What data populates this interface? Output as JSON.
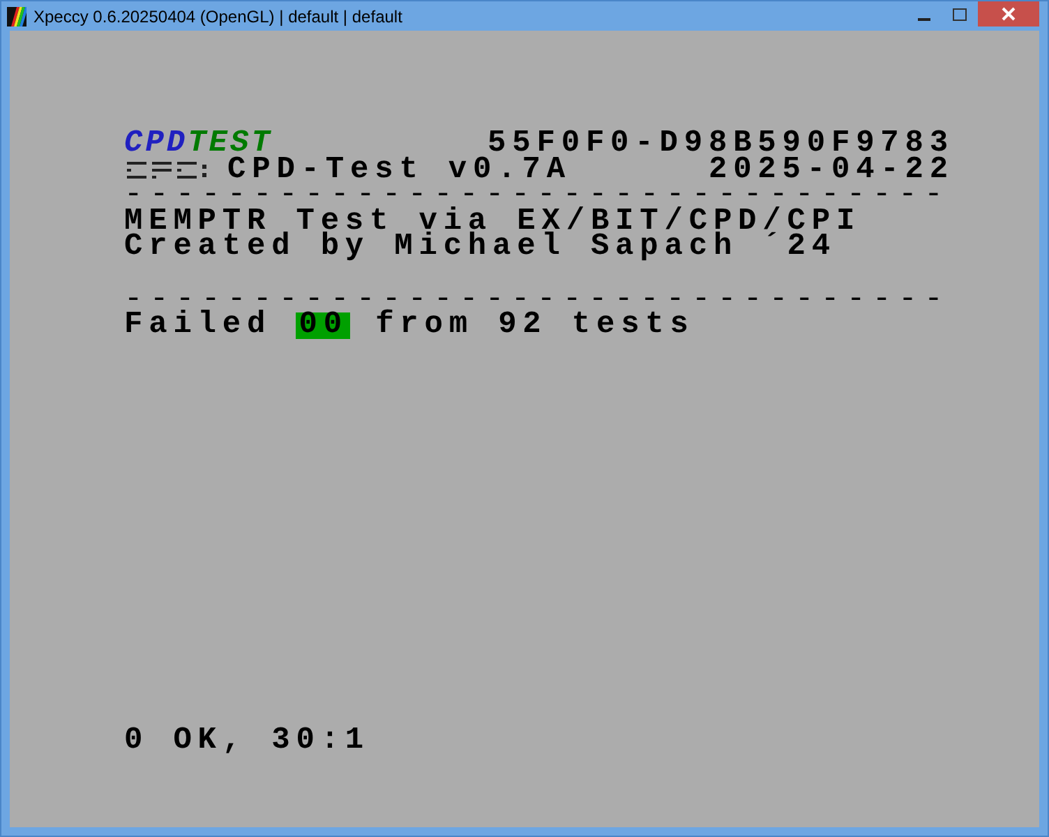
{
  "window": {
    "title": "Xpeccy 0.6.20250404 (OpenGL) | default | default"
  },
  "screen": {
    "logo": [
      {
        "text": "CPD",
        "color": "#2020c0"
      },
      {
        "text": "TEST",
        "color": "#007a00"
      }
    ],
    "id": "55F0F0-D98B590F9783",
    "version": "CPD-Test v0.7A",
    "date": "2025-04-22",
    "separator_1": "--------------------------------",
    "lines": [
      "MEMPTR Test via EX/BIT/CPD/CPI",
      "Created by Michael Sapach ´24"
    ],
    "separator_2": "--------------------------------",
    "result": {
      "prefix": "Failed",
      "count": "00",
      "suffix": "from 92 tests"
    },
    "status": "0 OK, 30:1"
  }
}
